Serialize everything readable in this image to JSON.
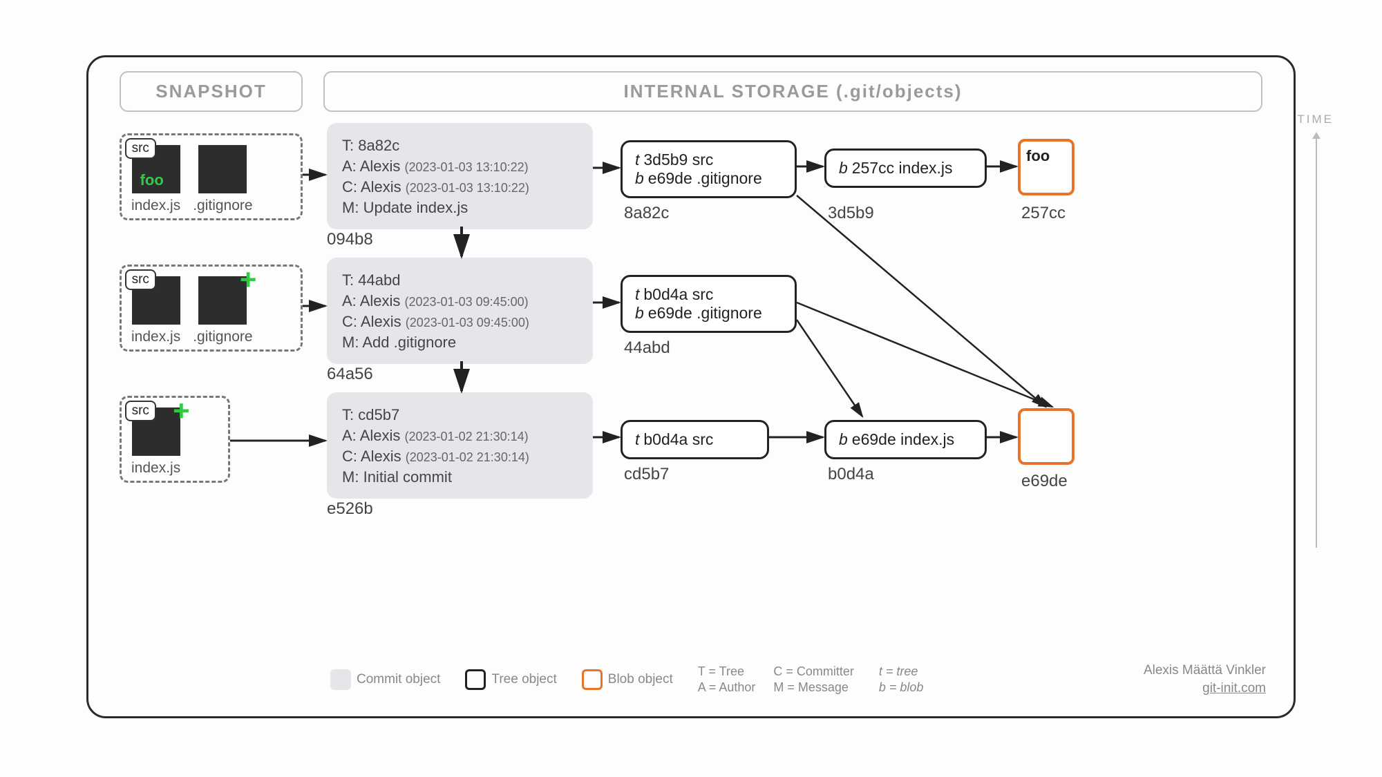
{
  "headers": {
    "snapshot": "SNAPSHOT",
    "storage": "INTERNAL STORAGE (.git/objects)"
  },
  "time_label": "TIME",
  "snapshots": [
    {
      "files": [
        {
          "name": "index.js",
          "folder": "src",
          "content": "foo"
        },
        {
          "name": ".gitignore"
        }
      ]
    },
    {
      "files": [
        {
          "name": "index.js",
          "folder": "src"
        },
        {
          "name": ".gitignore",
          "added": true
        }
      ]
    },
    {
      "files": [
        {
          "name": "index.js",
          "folder": "src",
          "added": true
        }
      ]
    }
  ],
  "commits": [
    {
      "hash": "094b8",
      "tree": "8a82c",
      "author": "Alexis",
      "author_ts": "(2023-01-03 13:10:22)",
      "committer": "Alexis",
      "committer_ts": "(2023-01-03 13:10:22)",
      "message": "Update index.js"
    },
    {
      "hash": "64a56",
      "tree": "44abd",
      "author": "Alexis",
      "author_ts": "(2023-01-03 09:45:00)",
      "committer": "Alexis",
      "committer_ts": "(2023-01-03 09:45:00)",
      "message": "Add .gitignore"
    },
    {
      "hash": "e526b",
      "tree": "cd5b7",
      "author": "Alexis",
      "author_ts": "(2023-01-02 21:30:14)",
      "committer": "Alexis",
      "committer_ts": "(2023-01-02 21:30:14)",
      "message": "Initial commit"
    }
  ],
  "trees": {
    "t0": {
      "hash": "8a82c",
      "entries": [
        "t 3d5b9 src",
        "b e69de .gitignore"
      ]
    },
    "t1": {
      "hash": "44abd",
      "entries": [
        "t b0d4a src",
        "b e69de .gitignore"
      ]
    },
    "t2": {
      "hash": "cd5b7",
      "entries": [
        "t b0d4a src"
      ]
    },
    "s0": {
      "hash": "3d5b9",
      "entry": "b 257cc index.js"
    },
    "s2": {
      "hash": "b0d4a",
      "entry": "b e69de index.js"
    }
  },
  "blobs": {
    "b0": {
      "hash": "257cc",
      "content": "foo"
    },
    "b1": {
      "hash": "e69de",
      "content": ""
    }
  },
  "legend": {
    "commit": "Commit object",
    "tree": "Tree object",
    "blob": "Blob object",
    "keys": {
      "T": "T = Tree",
      "A": "A = Author",
      "C": "C = Committer",
      "M": "M = Message",
      "t": "t = tree",
      "b": "b = blob"
    }
  },
  "credit": {
    "name": "Alexis Määttä Vinkler",
    "site": "git-init.com"
  },
  "labels": {
    "T": "T:",
    "A": "A:",
    "C": "C:",
    "M": "M:"
  }
}
